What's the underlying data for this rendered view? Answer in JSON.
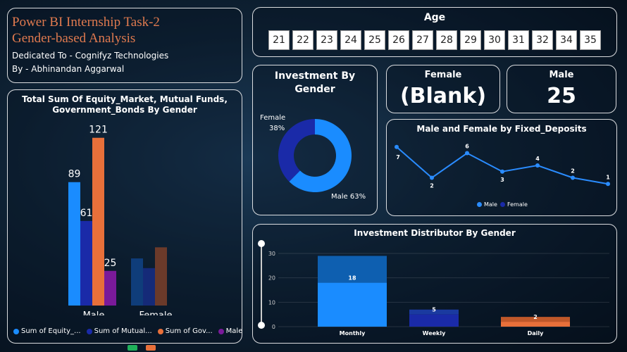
{
  "header": {
    "title_line1": "Power BI Internship Task-2",
    "title_line2": "Gender-based Analysis",
    "dedication": "Dedicated To - Cognifyz Technologies",
    "author": "By - Abhinandan Aggarwal"
  },
  "age_slicer": {
    "title": "Age",
    "items": [
      "21",
      "22",
      "23",
      "24",
      "25",
      "26",
      "27",
      "28",
      "29",
      "30",
      "31",
      "32",
      "34",
      "35"
    ]
  },
  "kpi_female": {
    "label": "Female",
    "value": "(Blank)"
  },
  "kpi_male": {
    "label": "Male",
    "value": "25"
  },
  "colors": {
    "equity": "#1a8cff",
    "mutual": "#1a2aa8",
    "gov": "#e8703a",
    "male_series": "#7a1a9a",
    "female_brown": "#6b3a2a",
    "line": "#2a8cff"
  },
  "chart_data": [
    {
      "type": "bar",
      "title": "Total Sum Of Equity_Market, Mutual Funds, Government_Bonds By Gender",
      "categories": [
        "Male",
        "Female"
      ],
      "series": [
        {
          "name": "Sum of Equity_...",
          "values": [
            89,
            34
          ],
          "labels": [
            "89",
            ""
          ]
        },
        {
          "name": "Sum of Mutual...",
          "values": [
            61,
            27
          ],
          "labels": [
            "61",
            ""
          ]
        },
        {
          "name": "Sum of Gov...",
          "values": [
            121,
            42
          ],
          "labels": [
            "121",
            ""
          ]
        },
        {
          "name": "Male",
          "values": [
            25,
            0
          ],
          "labels": [
            "25",
            ""
          ]
        }
      ],
      "ylim": [
        0,
        130
      ]
    },
    {
      "type": "pie",
      "title": "Investment By Gender",
      "slices": [
        {
          "label": "Female",
          "value": 38,
          "text": "38%"
        },
        {
          "label": "Male",
          "value": 63,
          "text": "63%"
        }
      ]
    },
    {
      "type": "line",
      "title": "Male and Female by Fixed_Deposits",
      "series": [
        {
          "name": "Male",
          "values": [
            7,
            2,
            6,
            3,
            4,
            2,
            1
          ]
        }
      ],
      "legend": [
        "Male",
        "Female"
      ],
      "ylim": [
        0,
        8
      ]
    },
    {
      "type": "bar",
      "title": "Investment Distributor By Gender",
      "categories": [
        "Monthly",
        "Weekly",
        "Daily"
      ],
      "values": [
        18,
        5,
        2
      ],
      "totals": [
        29,
        7,
        4
      ],
      "yticks": [
        "0",
        "10",
        "20",
        "30"
      ],
      "ylim": [
        0,
        30
      ]
    }
  ]
}
